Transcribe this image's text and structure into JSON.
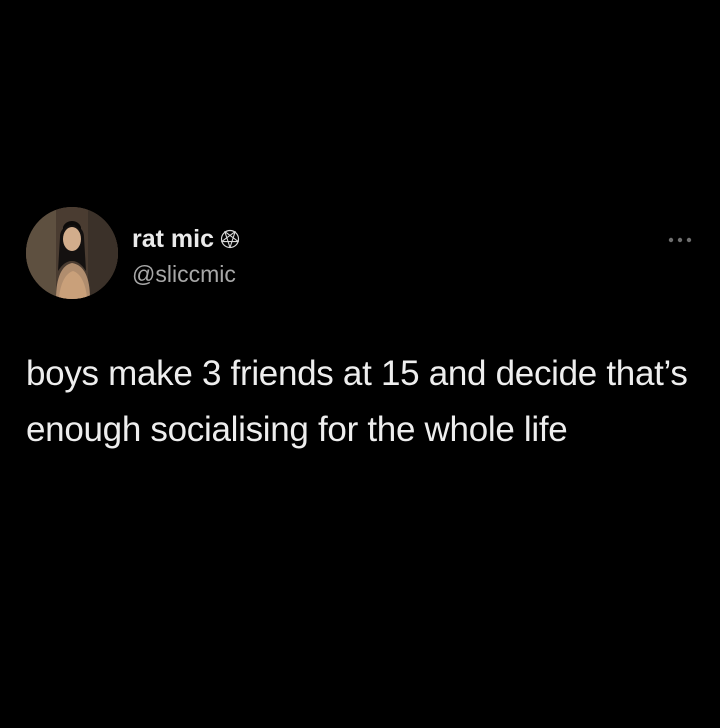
{
  "tweet": {
    "author": {
      "display_name": "rat mic",
      "name_symbol_icon": "pentagram-icon",
      "handle": "@sliccmic",
      "avatar_icon": "avatar"
    },
    "menu_icon": "more-icon",
    "text": "boys make 3 friends at 15 and decide that’s enough socialising for the whole life"
  },
  "theme": {
    "background": "#000000",
    "name_color": "#ebebeb",
    "handle_color": "#a8a8a8",
    "text_color": "#eeeeee"
  }
}
